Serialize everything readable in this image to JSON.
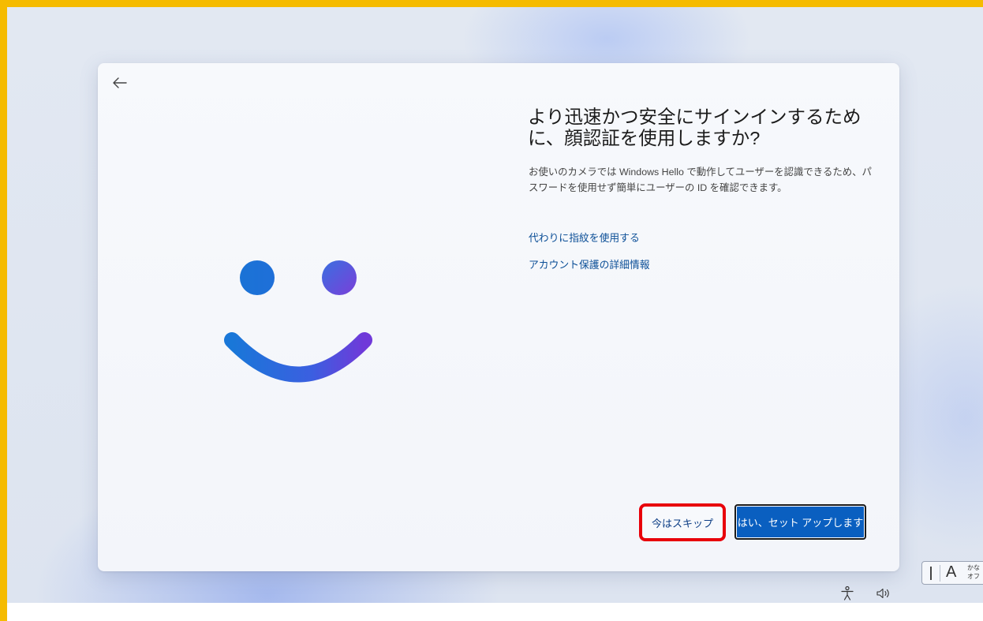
{
  "card": {
    "title": "より迅速かつ安全にサインインするために、顔認証を使用しますか?",
    "description": "お使いのカメラでは Windows Hello で動作してユーザーを認識できるため、パスワードを使用せず簡単にユーザーの ID を確認できます。",
    "links": {
      "fingerprint": "代わりに指紋を使用する",
      "learn_more": "アカウント保護の詳細情報"
    },
    "buttons": {
      "skip": "今はスキップ",
      "setup": "はい、セット アップします"
    }
  },
  "ime": {
    "mode_label": "A",
    "kana_line1": "かな",
    "kana_line2": "オフ"
  },
  "icons": {
    "back": "back-arrow-icon",
    "accessibility": "accessibility-icon",
    "volume": "volume-icon"
  },
  "colors": {
    "highlight_border": "#e8000a",
    "primary_button": "#0a5fc0",
    "link": "#0c4f97",
    "screenshot_frame": "#f5bb00"
  }
}
